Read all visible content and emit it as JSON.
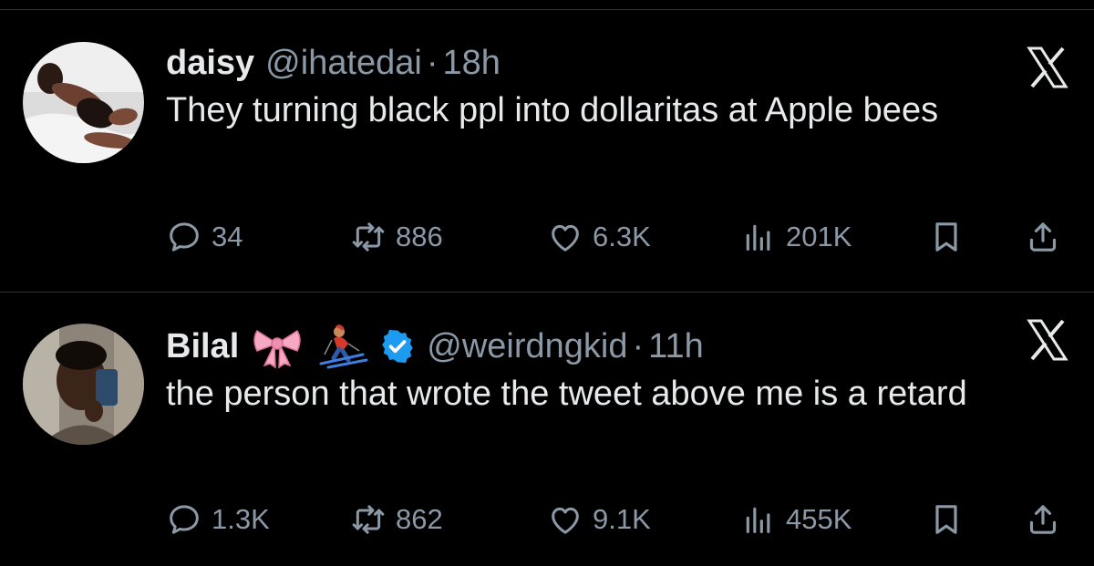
{
  "tweets": [
    {
      "name": "daisy",
      "handle": "@ihatedai",
      "separator": "·",
      "time": "18h",
      "text": "They turning black ppl into dollaritas at Apple bees",
      "verified": false,
      "name_emojis": [],
      "avatar": "profile-photo",
      "stats": {
        "replies": "34",
        "reposts": "886",
        "likes": "6.3K",
        "views": "201K"
      }
    },
    {
      "name": "Bilal",
      "handle": "@weirdngkid",
      "separator": "·",
      "time": "11h",
      "text": "the person that wrote the tweet above me is a retard",
      "verified": true,
      "name_emojis": [
        "ribbon-emoji",
        "skier-emoji"
      ],
      "avatar": "profile-photo",
      "stats": {
        "replies": "1.3K",
        "reposts": "862",
        "likes": "9.1K",
        "views": "455K"
      }
    }
  ],
  "icons": {
    "reply": "reply-icon",
    "repost": "repost-icon",
    "like": "heart-icon",
    "views": "views-icon",
    "bookmark": "bookmark-icon",
    "share": "share-icon",
    "close": "x-logo-icon",
    "verified": "verified-badge-icon"
  },
  "colors": {
    "background": "#000000",
    "text_primary": "#e7e9ea",
    "text_secondary": "#8b98a5",
    "divider": "#2f3336",
    "verified": "#1d9bf0"
  }
}
